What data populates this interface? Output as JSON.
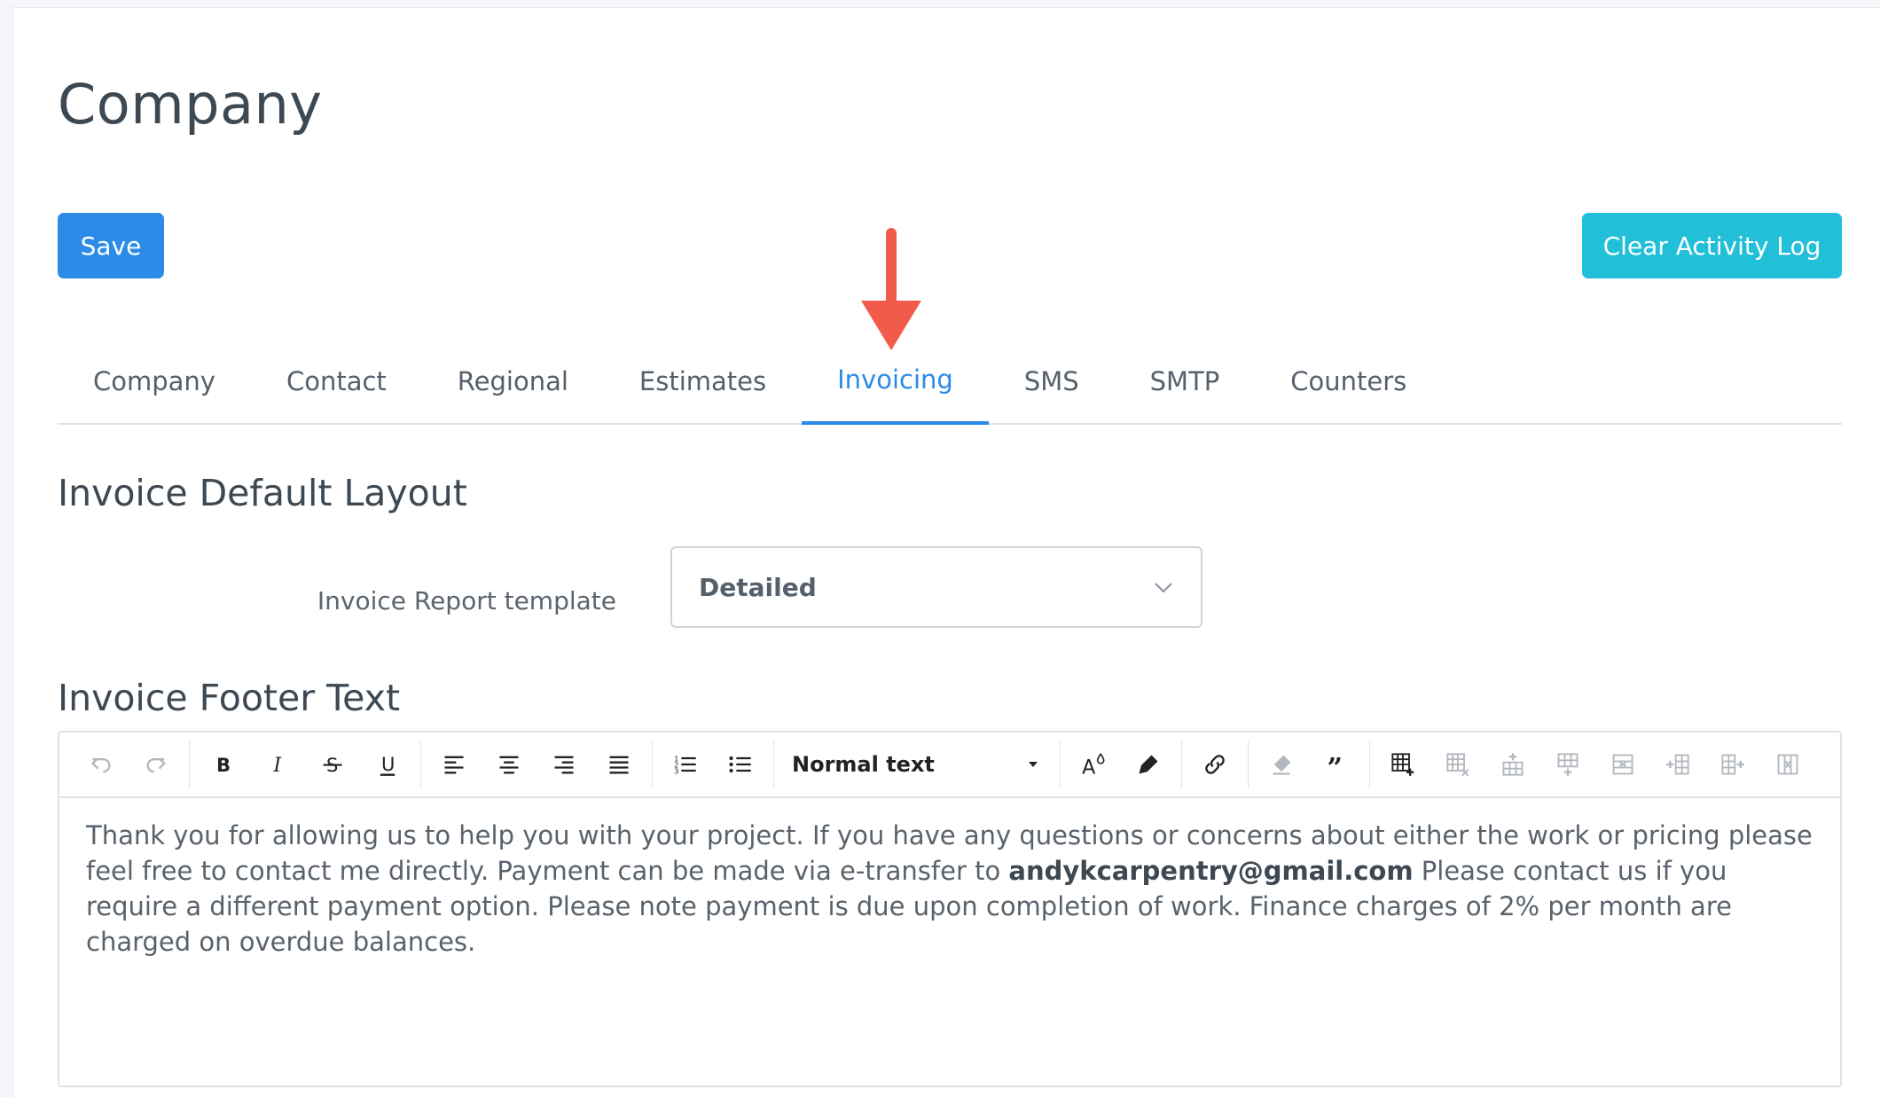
{
  "page": {
    "title": "Company"
  },
  "actions": {
    "save_label": "Save",
    "clear_log_label": "Clear Activity Log"
  },
  "colors": {
    "primary": "#2a8be8",
    "info": "#22c0d8",
    "annotation_arrow": "#f25a4c"
  },
  "tabs": [
    {
      "label": "Company",
      "active": false
    },
    {
      "label": "Contact",
      "active": false
    },
    {
      "label": "Regional",
      "active": false
    },
    {
      "label": "Estimates",
      "active": false
    },
    {
      "label": "Invoicing",
      "active": true
    },
    {
      "label": "SMS",
      "active": false
    },
    {
      "label": "SMTP",
      "active": false
    },
    {
      "label": "Counters",
      "active": false
    }
  ],
  "invoice_layout": {
    "heading": "Invoice Default Layout",
    "template_label": "Invoice Report template",
    "template_value": "Detailed"
  },
  "footer": {
    "heading": "Invoice Footer Text",
    "toolbar": {
      "format_value": "Normal text",
      "icons": [
        "undo-icon",
        "redo-icon",
        "bold-icon",
        "italic-icon",
        "strikethrough-icon",
        "underline-icon",
        "align-left-icon",
        "align-center-icon",
        "align-right-icon",
        "align-justify-icon",
        "ordered-list-icon",
        "bullet-list-icon",
        "font-color-icon",
        "highlight-icon",
        "link-icon",
        "clear-format-icon",
        "blockquote-icon",
        "insert-table-icon",
        "delete-table-icon",
        "insert-row-above-icon",
        "insert-row-below-icon",
        "delete-row-icon",
        "insert-column-left-icon",
        "insert-column-right-icon",
        "delete-column-icon"
      ]
    },
    "text_before": "Thank you for allowing us to help you with your project. If you have any questions or concerns about either the work or pricing please feel free to contact me directly. Payment can be made via e-transfer to ",
    "email": "andykcarpentry@gmail.com",
    "text_after": " Please contact us if you require a different payment option. Please note payment is due upon completion of work. Finance charges of 2% per month are charged on overdue balances."
  }
}
